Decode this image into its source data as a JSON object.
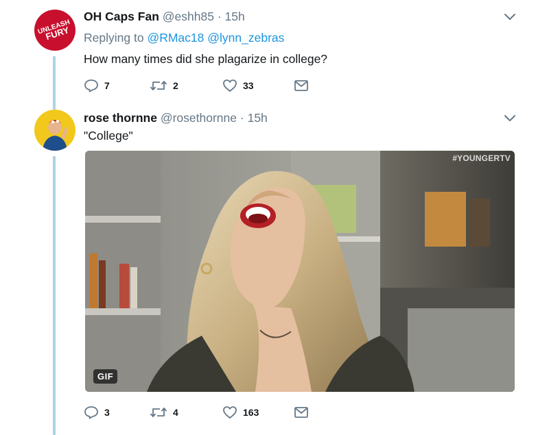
{
  "tweets": [
    {
      "display_name": "OH Caps Fan",
      "handle": "@eshh85",
      "separator": "·",
      "time": "15h",
      "replying_to_label": "Replying to",
      "mentions": [
        "@RMac18",
        "@lynn_zebras"
      ],
      "text": "How many times did she plagarize in college?",
      "avatar_text": "UNLEASH THE FURY",
      "replies": "7",
      "retweets": "2",
      "likes": "33"
    },
    {
      "display_name": "rose thornne",
      "handle": "@rosethornne",
      "separator": "·",
      "time": "15h",
      "text": "\"College\"",
      "media": {
        "badge": "GIF",
        "watermark": "#YOUNGERTV"
      },
      "replies": "3",
      "retweets": "4",
      "likes": "163"
    }
  ],
  "colors": {
    "accent": "#1b95e0",
    "thread_line": "#aad3ea",
    "secondary_text": "#657786"
  },
  "icons": [
    "chevron-down-icon",
    "reply-icon",
    "retweet-icon",
    "like-icon",
    "direct-message-icon"
  ]
}
